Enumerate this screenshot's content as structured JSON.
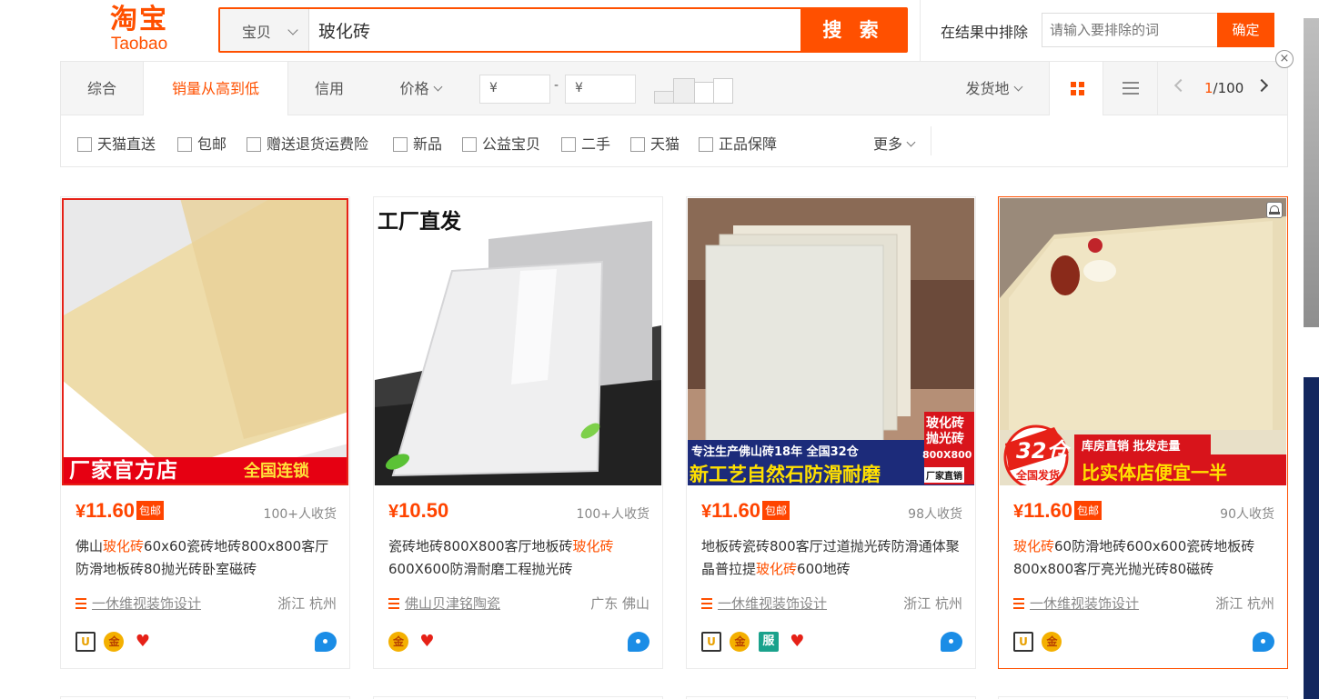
{
  "header": {
    "logo_cn": "淘宝",
    "logo_en": "Taobao",
    "search_type": "宝贝",
    "search_query": "玻化砖",
    "search_button": "搜 索",
    "exclude_label": "在结果中排除",
    "exclude_placeholder": "请输入要排除的词",
    "exclude_button": "确定"
  },
  "sort": {
    "tabs": [
      "综合",
      "销量从高到低",
      "信用",
      "价格"
    ],
    "active_tab": "销量从高到低",
    "price_from": "¥",
    "price_to": "¥",
    "price_dash": "-",
    "ship_from": "发货地",
    "page_current": "1",
    "page_total": "/100",
    "close": "×"
  },
  "filters": {
    "options": [
      "天猫直送",
      "包邮",
      "赠送退货运费险",
      "新品",
      "公益宝贝",
      "二手",
      "天猫",
      "正品保障"
    ],
    "more": "更多"
  },
  "products": [
    {
      "price_symbol": "¥",
      "price": "11.60",
      "free_shipping": "包邮",
      "sold": "100+人收货",
      "title_before": "佛山",
      "title_keyword": "玻化砖",
      "title_after": "60x60瓷砖地砖800x800客厅防滑地板砖80抛光砖卧室磁砖",
      "shop": "一休维视装饰设计",
      "location": "浙江 杭州",
      "image_text": [
        "厂家官方店",
        "全国连锁"
      ],
      "badges": [
        "house",
        "gold",
        "heart"
      ]
    },
    {
      "price_symbol": "¥",
      "price": "10.50",
      "free_shipping": "",
      "sold": "100+人收货",
      "title_before": "瓷砖地砖800X800客厅地板砖",
      "title_keyword": "玻化砖",
      "title_after": "600X600防滑耐磨工程抛光砖",
      "shop": "佛山贝津铭陶瓷",
      "location": "广东 佛山",
      "image_text": [
        "工厂直发"
      ],
      "badges": [
        "gold",
        "heart"
      ]
    },
    {
      "price_symbol": "¥",
      "price": "11.60",
      "free_shipping": "包邮",
      "sold": "98人收货",
      "title_before": "地板砖瓷砖800客厅过道抛光砖防滑通体聚晶普拉提",
      "title_keyword": "玻化砖",
      "title_after": "600地砖",
      "shop": "一休维视装饰设计",
      "location": "浙江 杭州",
      "image_text": [
        "专注生产佛山砖18年 全国32仓",
        "新工艺自然石防滑耐磨",
        "玻化砖",
        "抛光砖",
        "800X800",
        "厂家直销"
      ],
      "badges": [
        "house",
        "gold",
        "fu",
        "heart"
      ]
    },
    {
      "price_symbol": "¥",
      "price": "11.60",
      "free_shipping": "包邮",
      "sold": "90人收货",
      "title_before": "",
      "title_keyword": "玻化砖",
      "title_after": "60防滑地砖600x600瓷砖地板砖800x800客厅亮光抛光砖80磁砖",
      "shop": "一休维视装饰设计",
      "location": "浙江 杭州",
      "image_text": [
        "32仓",
        "全国发货",
        "库房直销 批发走量",
        "比实体店便宜一半"
      ],
      "badges": [
        "house",
        "gold"
      ]
    }
  ],
  "badge_labels": {
    "house": "U",
    "gold": "金",
    "heart": "♥",
    "fu": "服"
  },
  "colors": {
    "accent": "#ff5000",
    "price": "#ff4400",
    "badge_red": "#e62117"
  }
}
